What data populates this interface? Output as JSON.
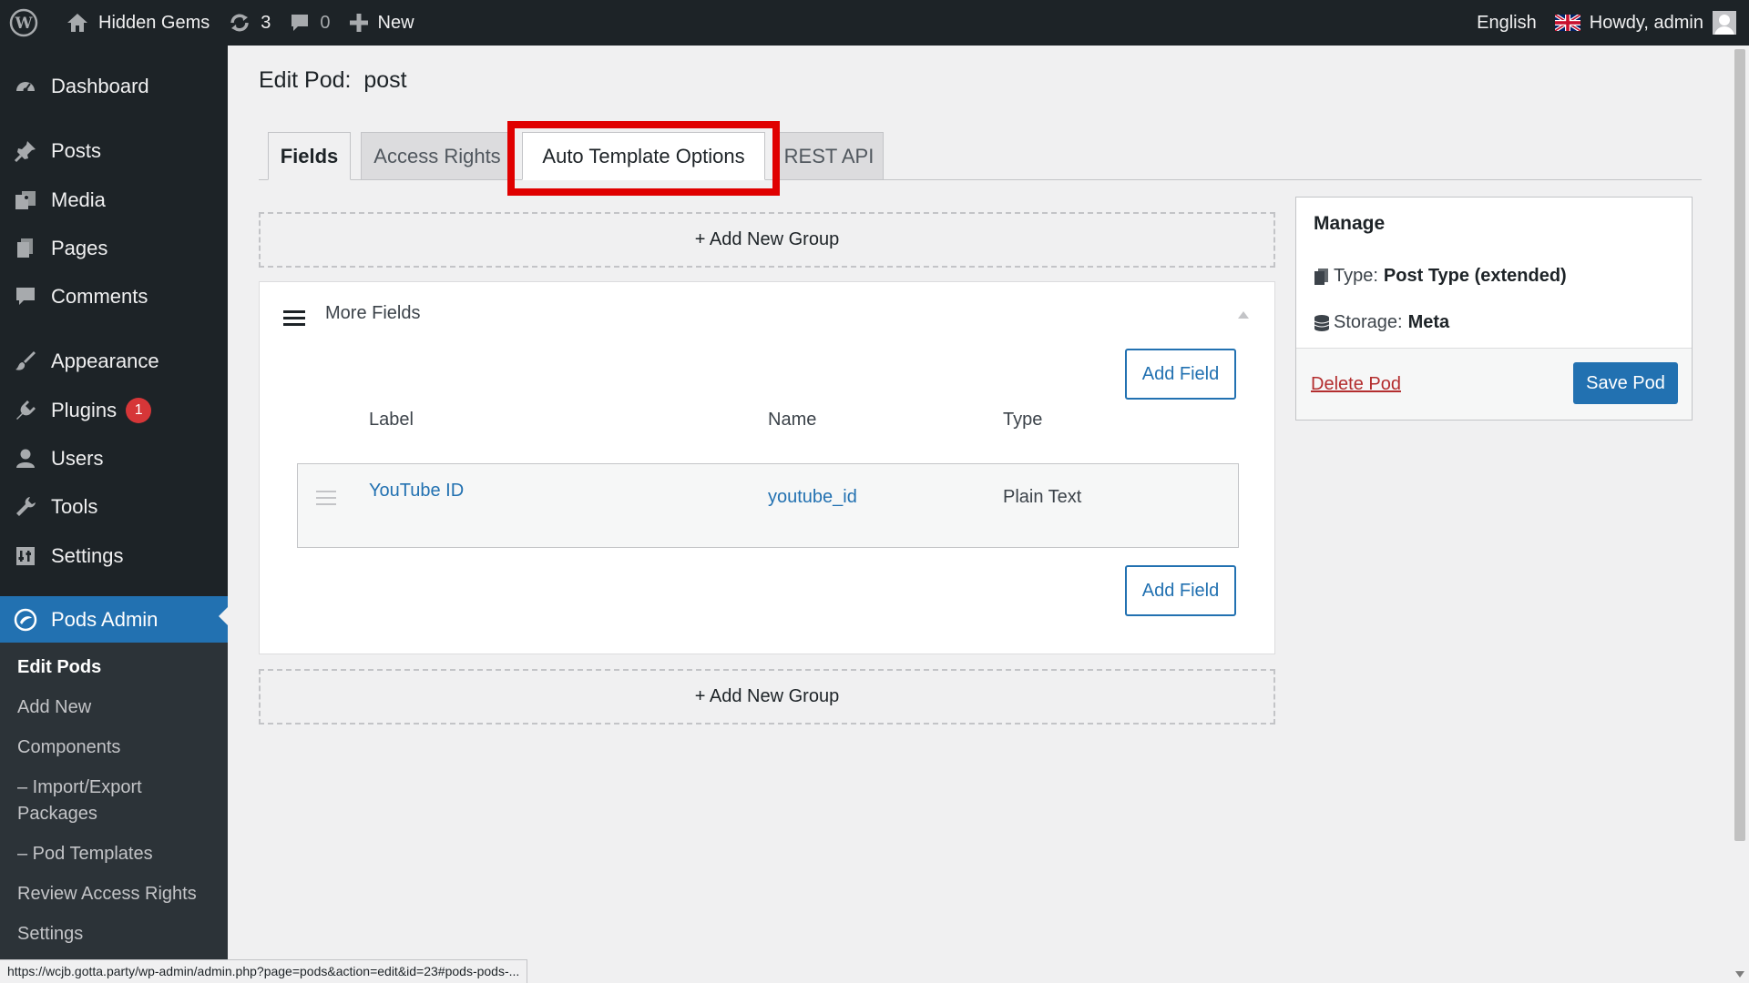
{
  "admin_bar": {
    "site_name": "Hidden Gems",
    "updates_count": "3",
    "comments_count": "0",
    "new_label": "New",
    "language": "English",
    "greeting": "Howdy, admin"
  },
  "sidebar": {
    "items": [
      {
        "label": "Dashboard",
        "icon": "dashboard-icon"
      },
      {
        "label": "Posts",
        "icon": "pin-icon"
      },
      {
        "label": "Media",
        "icon": "media-icon"
      },
      {
        "label": "Pages",
        "icon": "pages-icon"
      },
      {
        "label": "Comments",
        "icon": "comment-icon"
      },
      {
        "label": "Appearance",
        "icon": "brush-icon"
      },
      {
        "label": "Plugins",
        "icon": "plugin-icon",
        "badge": "1"
      },
      {
        "label": "Users",
        "icon": "user-icon"
      },
      {
        "label": "Tools",
        "icon": "wrench-icon"
      },
      {
        "label": "Settings",
        "icon": "settings-icon"
      },
      {
        "label": "Pods Admin",
        "icon": "pods-icon"
      }
    ],
    "submenu": [
      {
        "label": "Edit Pods"
      },
      {
        "label": "Add New"
      },
      {
        "label": "Components"
      },
      {
        "label": "– Import/Export Packages"
      },
      {
        "label": "– Pod Templates"
      },
      {
        "label": "Review Access Rights"
      },
      {
        "label": "Settings"
      }
    ]
  },
  "page": {
    "title": "Edit Pod:  post",
    "tabs": [
      {
        "label": "Fields"
      },
      {
        "label": "Access Rights"
      },
      {
        "label": "Auto Template Options"
      },
      {
        "label": "REST API"
      }
    ],
    "add_group_label": "+ Add New Group",
    "group": {
      "name": "More Fields",
      "add_field_label": "Add Field",
      "columns": {
        "label": "Label",
        "name": "Name",
        "type": "Type"
      },
      "rows": [
        {
          "label": "YouTube ID",
          "name": "youtube_id",
          "type": "Plain Text"
        }
      ]
    }
  },
  "manage": {
    "title": "Manage",
    "type_label": "Type:",
    "type_value": "Post Type (extended)",
    "storage_label": "Storage:",
    "storage_value": "Meta",
    "delete_label": "Delete Pod",
    "save_label": "Save Pod"
  },
  "status_url": "https://wcjb.gotta.party/wp-admin/admin.php?page=pods&action=edit&id=23#pods-pods-...",
  "colors": {
    "admin_dark": "#1d2327",
    "accent_blue": "#2271b1",
    "highlight_red": "#e00000",
    "danger": "#b32d2e"
  }
}
